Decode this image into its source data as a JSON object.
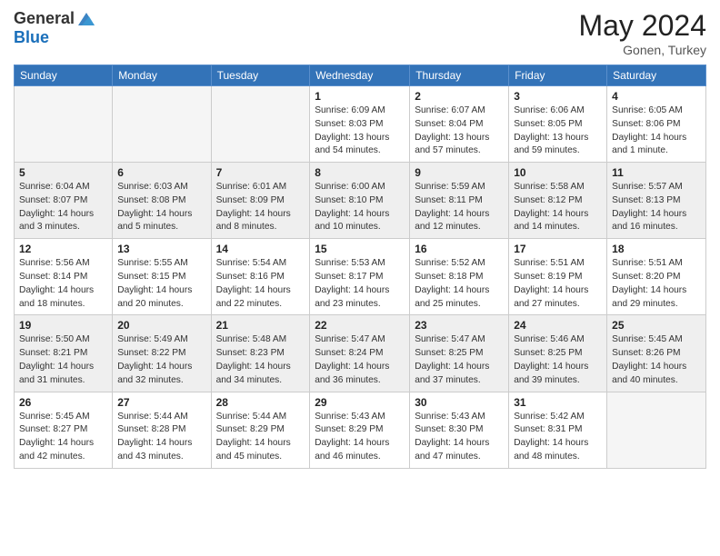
{
  "header": {
    "logo_line1": "General",
    "logo_line2": "Blue",
    "month_year": "May 2024",
    "location": "Gonen, Turkey"
  },
  "days_of_week": [
    "Sunday",
    "Monday",
    "Tuesday",
    "Wednesday",
    "Thursday",
    "Friday",
    "Saturday"
  ],
  "weeks": [
    [
      {
        "day": "",
        "info": ""
      },
      {
        "day": "",
        "info": ""
      },
      {
        "day": "",
        "info": ""
      },
      {
        "day": "1",
        "info": "Sunrise: 6:09 AM\nSunset: 8:03 PM\nDaylight: 13 hours\nand 54 minutes."
      },
      {
        "day": "2",
        "info": "Sunrise: 6:07 AM\nSunset: 8:04 PM\nDaylight: 13 hours\nand 57 minutes."
      },
      {
        "day": "3",
        "info": "Sunrise: 6:06 AM\nSunset: 8:05 PM\nDaylight: 13 hours\nand 59 minutes."
      },
      {
        "day": "4",
        "info": "Sunrise: 6:05 AM\nSunset: 8:06 PM\nDaylight: 14 hours\nand 1 minute."
      }
    ],
    [
      {
        "day": "5",
        "info": "Sunrise: 6:04 AM\nSunset: 8:07 PM\nDaylight: 14 hours\nand 3 minutes."
      },
      {
        "day": "6",
        "info": "Sunrise: 6:03 AM\nSunset: 8:08 PM\nDaylight: 14 hours\nand 5 minutes."
      },
      {
        "day": "7",
        "info": "Sunrise: 6:01 AM\nSunset: 8:09 PM\nDaylight: 14 hours\nand 8 minutes."
      },
      {
        "day": "8",
        "info": "Sunrise: 6:00 AM\nSunset: 8:10 PM\nDaylight: 14 hours\nand 10 minutes."
      },
      {
        "day": "9",
        "info": "Sunrise: 5:59 AM\nSunset: 8:11 PM\nDaylight: 14 hours\nand 12 minutes."
      },
      {
        "day": "10",
        "info": "Sunrise: 5:58 AM\nSunset: 8:12 PM\nDaylight: 14 hours\nand 14 minutes."
      },
      {
        "day": "11",
        "info": "Sunrise: 5:57 AM\nSunset: 8:13 PM\nDaylight: 14 hours\nand 16 minutes."
      }
    ],
    [
      {
        "day": "12",
        "info": "Sunrise: 5:56 AM\nSunset: 8:14 PM\nDaylight: 14 hours\nand 18 minutes."
      },
      {
        "day": "13",
        "info": "Sunrise: 5:55 AM\nSunset: 8:15 PM\nDaylight: 14 hours\nand 20 minutes."
      },
      {
        "day": "14",
        "info": "Sunrise: 5:54 AM\nSunset: 8:16 PM\nDaylight: 14 hours\nand 22 minutes."
      },
      {
        "day": "15",
        "info": "Sunrise: 5:53 AM\nSunset: 8:17 PM\nDaylight: 14 hours\nand 23 minutes."
      },
      {
        "day": "16",
        "info": "Sunrise: 5:52 AM\nSunset: 8:18 PM\nDaylight: 14 hours\nand 25 minutes."
      },
      {
        "day": "17",
        "info": "Sunrise: 5:51 AM\nSunset: 8:19 PM\nDaylight: 14 hours\nand 27 minutes."
      },
      {
        "day": "18",
        "info": "Sunrise: 5:51 AM\nSunset: 8:20 PM\nDaylight: 14 hours\nand 29 minutes."
      }
    ],
    [
      {
        "day": "19",
        "info": "Sunrise: 5:50 AM\nSunset: 8:21 PM\nDaylight: 14 hours\nand 31 minutes."
      },
      {
        "day": "20",
        "info": "Sunrise: 5:49 AM\nSunset: 8:22 PM\nDaylight: 14 hours\nand 32 minutes."
      },
      {
        "day": "21",
        "info": "Sunrise: 5:48 AM\nSunset: 8:23 PM\nDaylight: 14 hours\nand 34 minutes."
      },
      {
        "day": "22",
        "info": "Sunrise: 5:47 AM\nSunset: 8:24 PM\nDaylight: 14 hours\nand 36 minutes."
      },
      {
        "day": "23",
        "info": "Sunrise: 5:47 AM\nSunset: 8:25 PM\nDaylight: 14 hours\nand 37 minutes."
      },
      {
        "day": "24",
        "info": "Sunrise: 5:46 AM\nSunset: 8:25 PM\nDaylight: 14 hours\nand 39 minutes."
      },
      {
        "day": "25",
        "info": "Sunrise: 5:45 AM\nSunset: 8:26 PM\nDaylight: 14 hours\nand 40 minutes."
      }
    ],
    [
      {
        "day": "26",
        "info": "Sunrise: 5:45 AM\nSunset: 8:27 PM\nDaylight: 14 hours\nand 42 minutes."
      },
      {
        "day": "27",
        "info": "Sunrise: 5:44 AM\nSunset: 8:28 PM\nDaylight: 14 hours\nand 43 minutes."
      },
      {
        "day": "28",
        "info": "Sunrise: 5:44 AM\nSunset: 8:29 PM\nDaylight: 14 hours\nand 45 minutes."
      },
      {
        "day": "29",
        "info": "Sunrise: 5:43 AM\nSunset: 8:29 PM\nDaylight: 14 hours\nand 46 minutes."
      },
      {
        "day": "30",
        "info": "Sunrise: 5:43 AM\nSunset: 8:30 PM\nDaylight: 14 hours\nand 47 minutes."
      },
      {
        "day": "31",
        "info": "Sunrise: 5:42 AM\nSunset: 8:31 PM\nDaylight: 14 hours\nand 48 minutes."
      },
      {
        "day": "",
        "info": ""
      }
    ]
  ]
}
